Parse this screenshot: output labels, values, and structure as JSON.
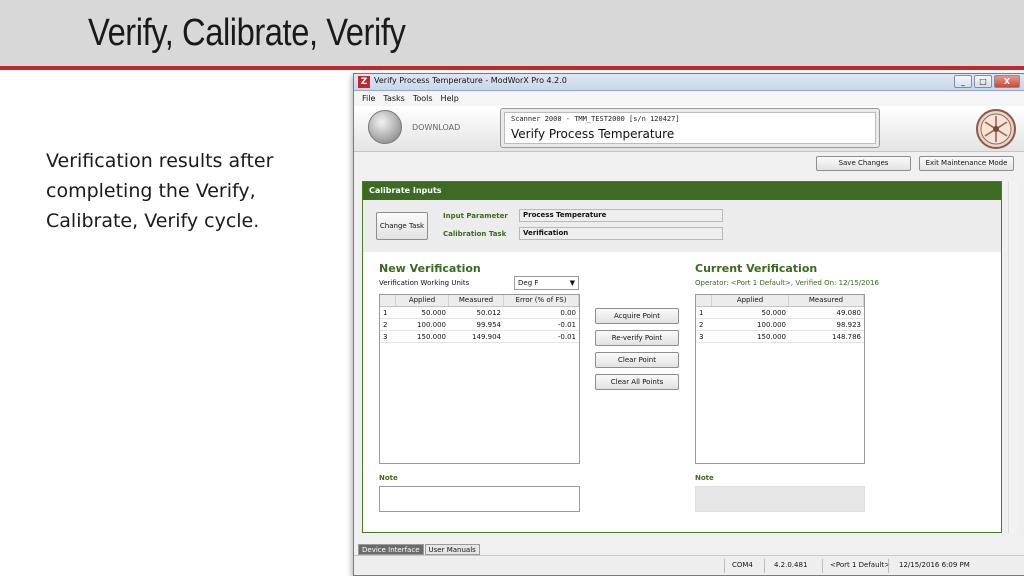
{
  "slide": {
    "title": "Verify, Calibrate, Verify",
    "body": "Verification results after completing the Verify, Calibrate, Verify cycle."
  },
  "window": {
    "title": "Verify Process Temperature - ModWorX Pro 4.2.0",
    "logo_glyph": "Z",
    "minimize": "_",
    "maximize": "□",
    "close": "X"
  },
  "menu": {
    "items": [
      "File",
      "Tasks",
      "Tools",
      "Help"
    ]
  },
  "toolbar": {
    "download_label": "DOWNLOAD",
    "device_id": "Scanner 2000 - TMM_TEST2000 [s/n 120427]",
    "device_task": "Verify Process Temperature"
  },
  "actions": {
    "save_changes": "Save Changes",
    "exit_maintenance": "Exit Maintenance Mode"
  },
  "calibrate": {
    "header": "Calibrate Inputs",
    "change_task": "Change Task",
    "input_parameter_label": "Input Parameter",
    "input_parameter_value": "Process Temperature",
    "calibration_task_label": "Calibration Task",
    "calibration_task_value": "Verification"
  },
  "new_verification": {
    "title": "New Verification",
    "units_label": "Verification Working Units",
    "units_value": "Deg F",
    "columns": [
      "",
      "Applied",
      "Measured",
      "Error (% of FS)"
    ],
    "rows": [
      [
        "1",
        "50.000",
        "50.012",
        "0.00"
      ],
      [
        "2",
        "100.000",
        "99.954",
        "-0.01"
      ],
      [
        "3",
        "150.000",
        "149.904",
        "-0.01"
      ]
    ],
    "note_label": "Note"
  },
  "point_buttons": {
    "acquire": "Acquire Point",
    "reverify": "Re-verify Point",
    "clear": "Clear Point",
    "clear_all": "Clear All Points"
  },
  "current_verification": {
    "title": "Current Verification",
    "operator_line": "Operator: <Port 1 Default>, Verified On: 12/15/2016",
    "columns": [
      "",
      "Applied",
      "Measured"
    ],
    "rows": [
      [
        "1",
        "50.000",
        "49.080"
      ],
      [
        "2",
        "100.000",
        "98.923"
      ],
      [
        "3",
        "150.000",
        "148.786"
      ]
    ],
    "note_label": "Note"
  },
  "tabs": {
    "device_interface": "Device Interface",
    "user_manuals": "User Manuals"
  },
  "status": {
    "port": "COM4",
    "version": "4.2.0.481",
    "user": "<Port 1 Default>",
    "datetime": "12/15/2016 6:09 PM"
  },
  "colors": {
    "accent_red": "#c0282d",
    "panel_green": "#3e6b23",
    "label_green": "#3a6a1e"
  }
}
